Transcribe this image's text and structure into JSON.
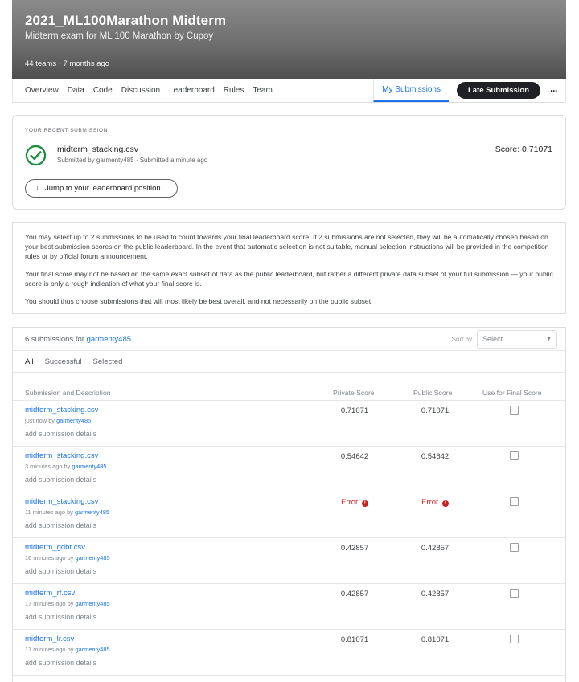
{
  "competition": {
    "title": "2021_ML100Marathon Midterm",
    "subtitle": "Midterm exam for ML 100 Marathon by Cupoy",
    "meta": "44 teams · 7 months ago"
  },
  "nav": {
    "tabs": [
      "Overview",
      "Data",
      "Code",
      "Discussion",
      "Leaderboard",
      "Rules",
      "Team"
    ],
    "my_submissions": "My Submissions",
    "late_submission": "Late Submission",
    "more": "···"
  },
  "recent": {
    "label": "YOUR RECENT SUBMISSION",
    "file": "midterm_stacking.csv",
    "by": "Submitted by garmenty485 · Submitted a minute ago",
    "score": "Score: 0.71071",
    "jump_button": "Jump to your leaderboard position",
    "status_icon": "check-circle-icon",
    "status_color": "#1e8e3e"
  },
  "info": {
    "p1": "You may select up to 2 submissions to be used to count towards your final leaderboard score. If 2 submissions are not selected, they will be automatically chosen based on your best submission scores on the public leaderboard. In the event that automatic selection is not suitable, manual selection instructions will be provided in the competition rules or by official forum announcement.",
    "p2": "Your final score may not be based on the same exact subset of data as the public leaderboard, but rather a different private data subset of your full submission — your public score is only a rough indication of what your final score is.",
    "p3": "You should thus choose submissions that will most likely be best overall, and not necessarily on the public subset."
  },
  "submissions": {
    "count_prefix": "6 submissions for",
    "user": "garmenty485",
    "sort_label": "Sort by",
    "sort_placeholder": "Select...",
    "filters": [
      "All",
      "Successful",
      "Selected"
    ],
    "headers": {
      "description": "Submission and Description",
      "private": "Private Score",
      "public": "Public Score",
      "final": "Use for Final Score"
    },
    "details_label": "add submission details",
    "by_label": "by",
    "error_label": "Error",
    "rows": [
      {
        "name": "midterm_stacking.csv",
        "time": "just now",
        "private": "0.71071",
        "public": "0.71071",
        "error": false
      },
      {
        "name": "midterm_stacking.csv",
        "time": "3 minutes ago",
        "private": "0.54642",
        "public": "0.54642",
        "error": false
      },
      {
        "name": "midterm_stacking.csv",
        "time": "11 minutes ago",
        "private": "Error",
        "public": "Error",
        "error": true
      },
      {
        "name": "midterm_gdbt.csv",
        "time": "16 minutes ago",
        "private": "0.42857",
        "public": "0.42857",
        "error": false
      },
      {
        "name": "midterm_rf.csv",
        "time": "17 minutes ago",
        "private": "0.42857",
        "public": "0.42857",
        "error": false
      },
      {
        "name": "midterm_lr.csv",
        "time": "17 minutes ago",
        "private": "0.81071",
        "public": "0.81071",
        "error": false
      }
    ]
  }
}
